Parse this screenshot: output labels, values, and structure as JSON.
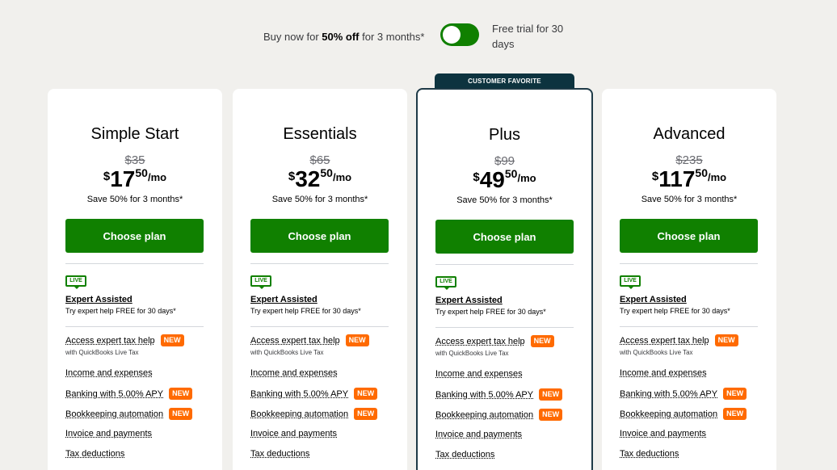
{
  "promo": {
    "prefix": "Buy now for ",
    "bold": "50% off",
    "suffix": " for 3 months*",
    "trial": "Free trial for 30 days"
  },
  "badge": "CUSTOMER FAVORITE",
  "plans": [
    {
      "name": "Simple Start",
      "old": "$35",
      "cur": "$",
      "int": "17",
      "cents": "50",
      "per": "/mo"
    },
    {
      "name": "Essentials",
      "old": "$65",
      "cur": "$",
      "int": "32",
      "cents": "50",
      "per": "/mo"
    },
    {
      "name": "Plus",
      "old": "$99",
      "cur": "$",
      "int": "49",
      "cents": "50",
      "per": "/mo"
    },
    {
      "name": "Advanced",
      "old": "$235",
      "cur": "$",
      "int": "117",
      "cents": "50",
      "per": "/mo"
    }
  ],
  "common": {
    "save": "Save 50% for 3 months*",
    "cta": "Choose plan",
    "live": "LIVE",
    "expert_title": "Expert Assisted",
    "expert_sub": "Try expert help FREE for 30 days*",
    "new": "NEW",
    "features": [
      {
        "label": "Access expert tax help",
        "new": true,
        "sub": "with QuickBooks Live Tax"
      },
      {
        "label": "Income and expenses",
        "new": false
      },
      {
        "label": "Banking with 5.00% APY",
        "new": true
      },
      {
        "label": "Bookkeeping automation",
        "new": true
      },
      {
        "label": "Invoice and payments",
        "new": false
      },
      {
        "label": "Tax deductions",
        "new": false
      }
    ]
  }
}
